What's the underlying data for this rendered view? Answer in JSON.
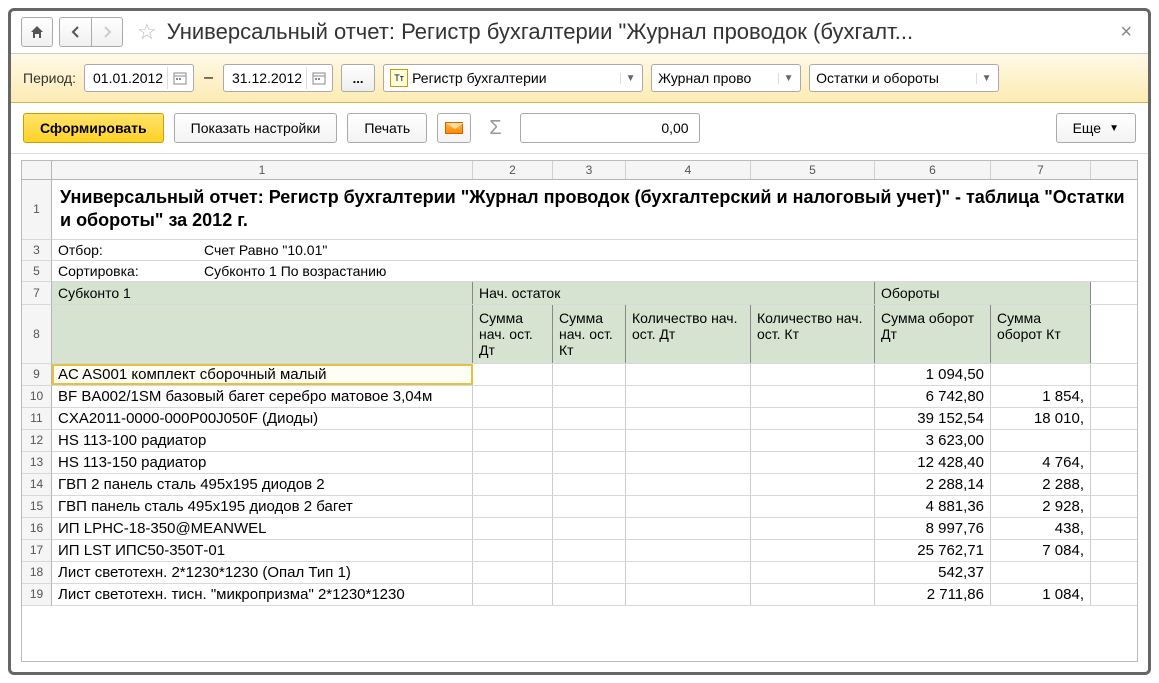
{
  "window": {
    "title": "Универсальный отчет: Регистр бухгалтерии \"Журнал проводок (бухгалт..."
  },
  "toolbar1": {
    "period_label": "Период:",
    "date_from": "01.01.2012",
    "date_to": "31.12.2012",
    "combo_register": "Регистр бухгалтерии",
    "combo_journal": "Журнал прово",
    "combo_mode": "Остатки и обороты"
  },
  "toolbar2": {
    "form": "Сформировать",
    "settings": "Показать настройки",
    "print": "Печать",
    "sum_value": "0,00",
    "more": "Еще"
  },
  "ruler": [
    "1",
    "2",
    "3",
    "4",
    "5",
    "6",
    "7"
  ],
  "ruler_widths": [
    421,
    80,
    73,
    125,
    124,
    116,
    100
  ],
  "report": {
    "title": "Универсальный отчет: Регистр бухгалтерии \"Журнал проводок (бухгалтерский и налоговый учет)\" - таблица \"Остатки и обороты\" за 2012 г.",
    "filter_label": "Отбор:",
    "filter_value": "Счет Равно \"10.01\"",
    "sort_label": "Сортировка:",
    "sort_value": "Субконто 1 По возрастанию"
  },
  "headers": {
    "group1": "Субконто 1",
    "group2": "Нач. остаток",
    "group3": "Обороты",
    "c1": "Сумма нач. ост. Дт",
    "c2": "Сумма нач. ост. Кт",
    "c3": "Количество нач. ост. Дт",
    "c4": "Количество нач. ост. Кт",
    "c5": "Сумма оборот Дт",
    "c6": "Сумма оборот Кт"
  },
  "rows": [
    {
      "n": "9",
      "name": "AC AS001 комплект сборочный малый",
      "dt": "1 094,50",
      "kt": "",
      "selected": true
    },
    {
      "n": "10",
      "name": "BF BA002/1SM базовый багет серебро матовое 3,04м",
      "dt": "6 742,80",
      "kt": "1 854,"
    },
    {
      "n": "11",
      "name": "CXA2011-0000-000P00J050F (Диоды)",
      "dt": "39 152,54",
      "kt": "18 010,"
    },
    {
      "n": "12",
      "name": "HS 113-100 радиатор",
      "dt": "3 623,00",
      "kt": ""
    },
    {
      "n": "13",
      "name": "HS 113-150 радиатор",
      "dt": "12 428,40",
      "kt": "4 764,"
    },
    {
      "n": "14",
      "name": "ГВП 2 панель сталь 495х195 диодов 2",
      "dt": "2 288,14",
      "kt": "2 288,"
    },
    {
      "n": "15",
      "name": "ГВП панель сталь 495х195 диодов 2 багет",
      "dt": "4 881,36",
      "kt": "2 928,"
    },
    {
      "n": "16",
      "name": "ИП LPHC-18-350@MEANWEL",
      "dt": "8 997,76",
      "kt": "438,"
    },
    {
      "n": "17",
      "name": "ИП LST ИПС50-350Т-01",
      "dt": "25 762,71",
      "kt": "7 084,"
    },
    {
      "n": "18",
      "name": "Лист светотехн. 2*1230*1230 (Опал Тип 1)",
      "dt": "542,37",
      "kt": ""
    },
    {
      "n": "19",
      "name": "Лист светотехн. тисн. \"микропризма\" 2*1230*1230",
      "dt": "2 711,86",
      "kt": "1 084,"
    }
  ]
}
